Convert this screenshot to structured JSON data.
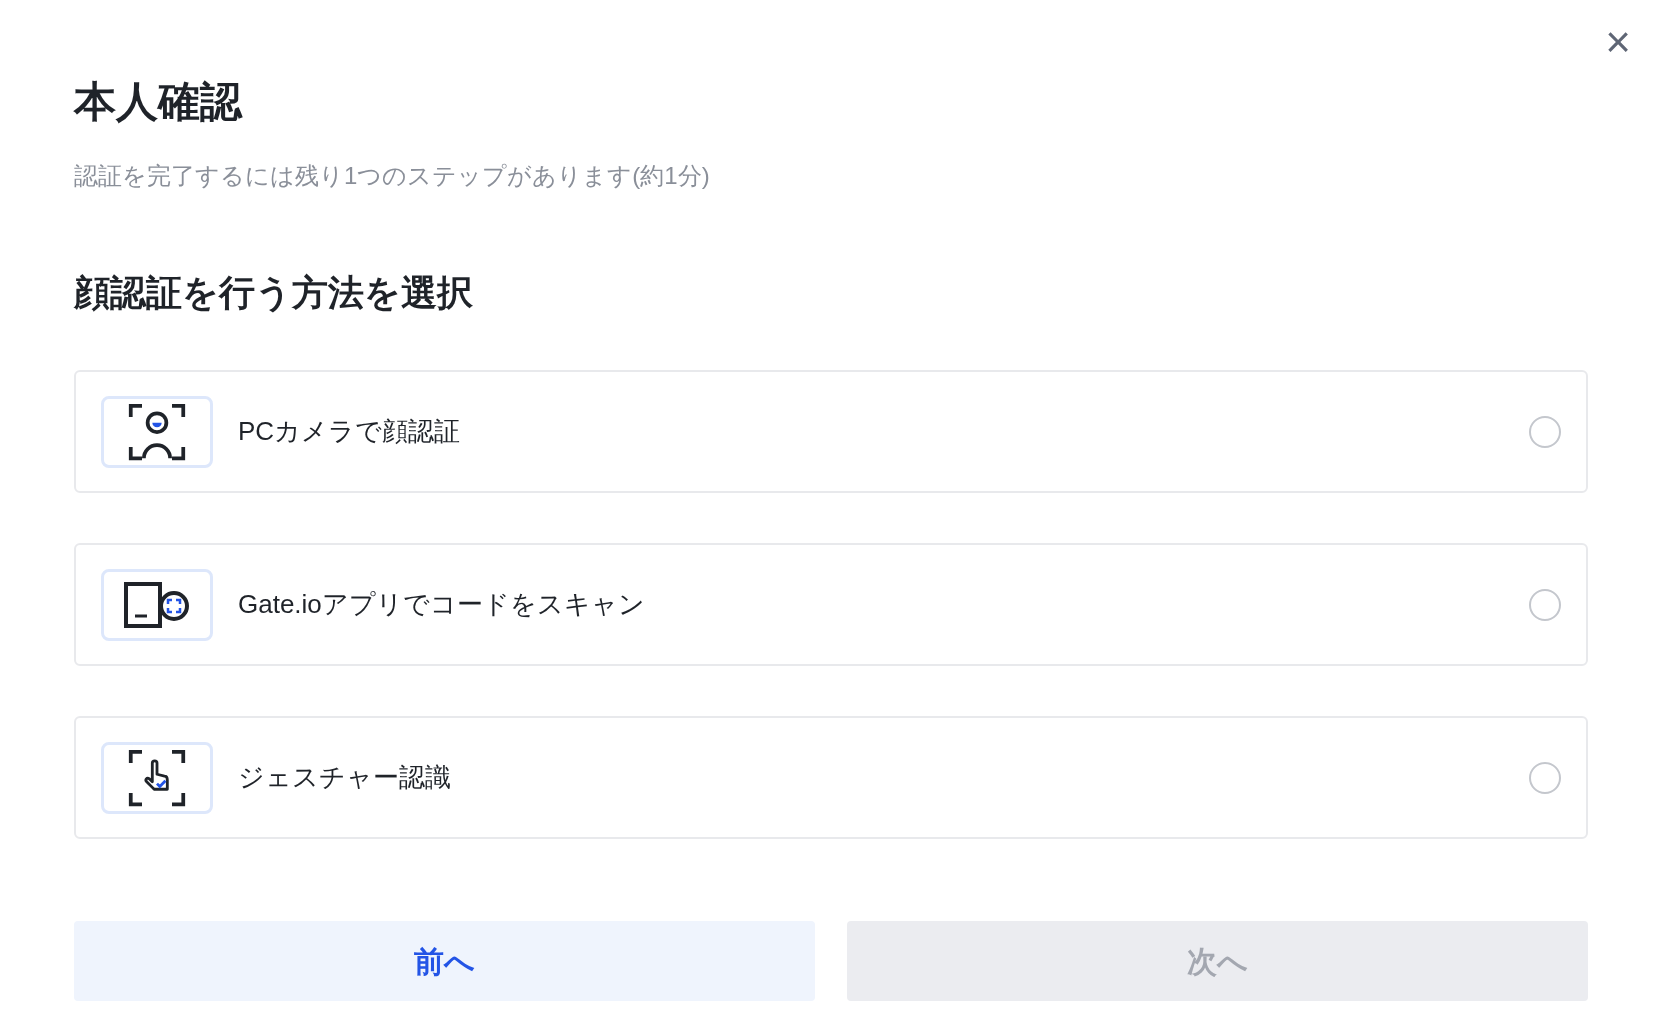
{
  "dialog": {
    "title": "本人確認",
    "subtitle": "認証を完了するには残り1つのステップがあります(約1分)",
    "close": "×"
  },
  "section_heading": "顔認証を行う方法を選択",
  "options": [
    {
      "kind": "face",
      "label": "PCカメラで顔認証",
      "selected": false
    },
    {
      "kind": "scan",
      "label": "Gate.ioアプリでコードをスキャン",
      "selected": false
    },
    {
      "kind": "gesture",
      "label": "ジェスチャー認識",
      "selected": false
    }
  ],
  "buttons": [
    {
      "label": "前へ",
      "disabled": false
    },
    {
      "label": "次へ",
      "disabled": true
    }
  ]
}
